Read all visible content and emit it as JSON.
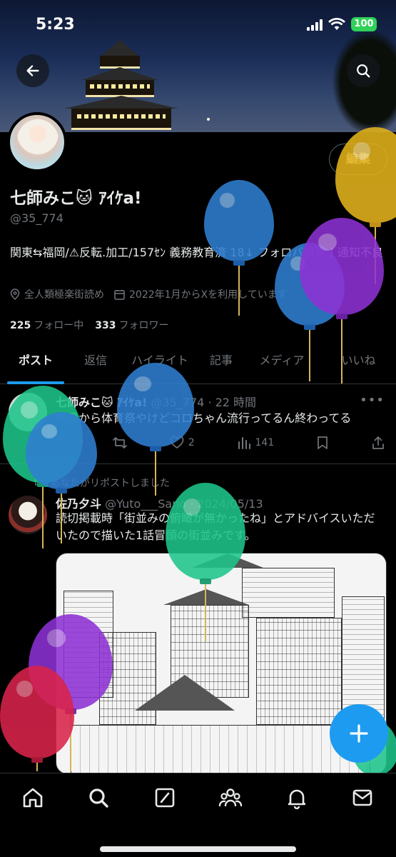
{
  "status_bar": {
    "time": "5:23",
    "battery": "100"
  },
  "header": {
    "back_icon": "arrow-left-icon",
    "search_icon": "search-icon"
  },
  "profile": {
    "edit_label": "編集",
    "display_name": "七師みこ🐱 ｱｲｹa!",
    "handle": "@35_774",
    "bio": "関東⇆福岡/⚠反転.加工/157ｾﾝ 義務教育済 18↓ フォロバ慎重 | 通知不良",
    "location": "全人類極楽街読め",
    "joined": "2022年1月からXを利用しています",
    "following_count": "225",
    "following_label": "フォロー中",
    "followers_count": "333",
    "followers_label": "フォロワー"
  },
  "tabs": [
    "ポスト",
    "返信",
    "ハイライト",
    "記事",
    "メディア",
    "いいね"
  ],
  "posts": [
    {
      "name": "七師みこ🐱 ｱｲｹa!",
      "handle_time": "@35_774 · 22 時間",
      "text": "昨日から体育祭やけどコロちゃん流行ってるん終わってる",
      "like_count": "2",
      "view_count": "141"
    },
    {
      "repost_label": "あなたがリポストしました",
      "name": "佐乃夕斗",
      "handle_time": "@Yuto___Sano · 2024/05/13",
      "text": "読切掲載時「街並みの俯瞰が無かったね」とアドバイスいただいたので描いた1話冒頭の街並みです。"
    }
  ],
  "nav_icons": [
    "home-icon",
    "search-icon",
    "grok-icon",
    "communities-icon",
    "notifications-icon",
    "messages-icon"
  ],
  "colors": {
    "accent": "#1d9bf0",
    "battery": "#30d158",
    "background": "#000000"
  }
}
